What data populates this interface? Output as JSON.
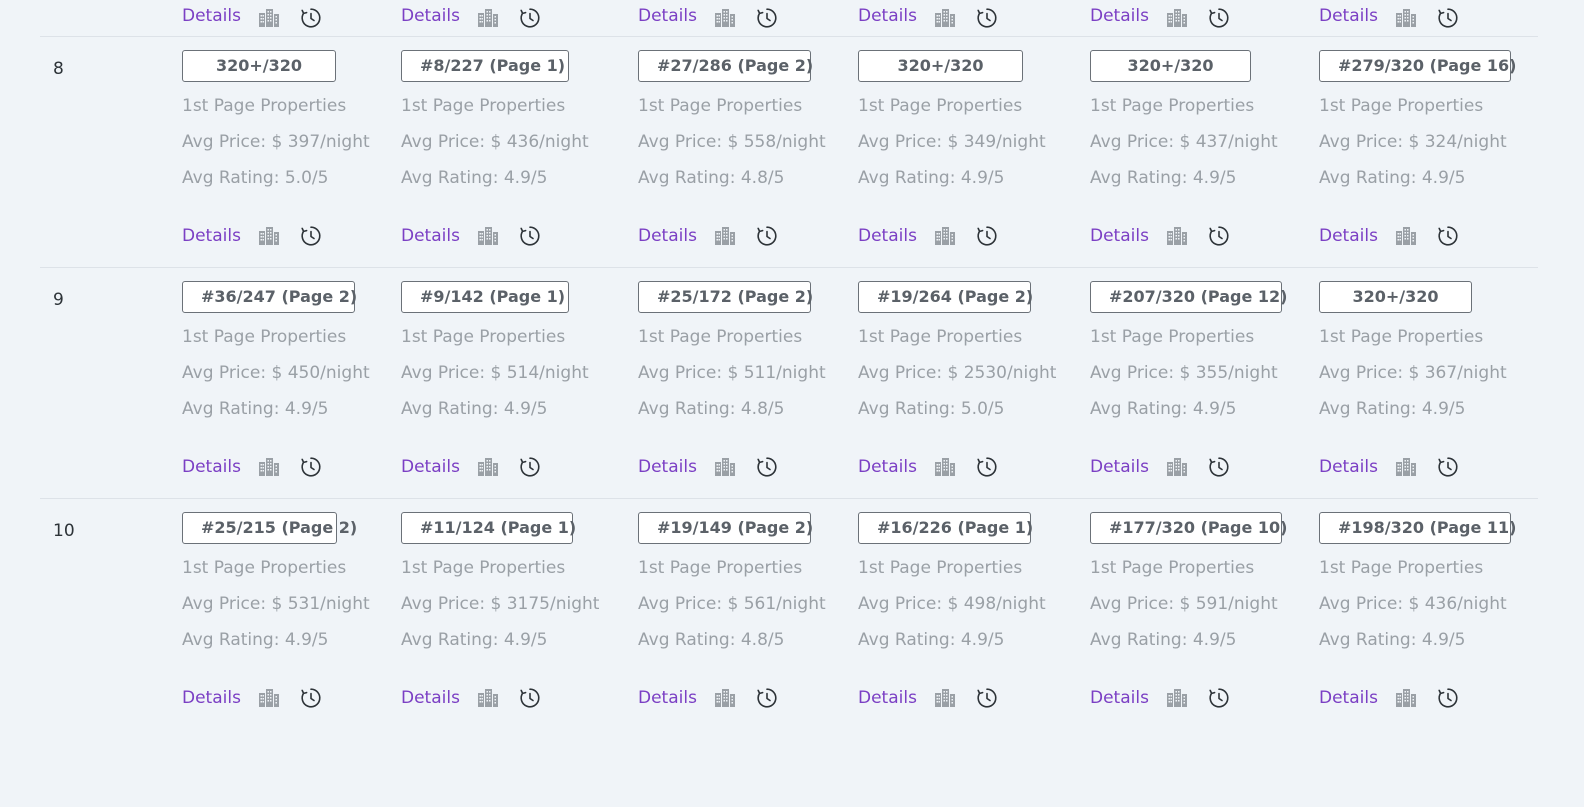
{
  "common": {
    "first_page_label": "1st Page Properties",
    "details_label": "Details",
    "avg_price_prefix": "Avg Price: $ ",
    "avg_price_suffix": "/night",
    "avg_rating_prefix": "Avg Rating: ",
    "avg_rating_suffix": "/5",
    "link_color": "#7b3fc4",
    "icons": [
      "building-icon",
      "history-clock-icon"
    ]
  },
  "rows": [
    {
      "number": "8",
      "cells": [
        {
          "rank": "320+/320",
          "avg_price": "397",
          "avg_rating": "5.0"
        },
        {
          "rank": "#8/227 (Page 1)",
          "avg_price": "436",
          "avg_rating": "4.9"
        },
        {
          "rank": "#27/286 (Page 2)",
          "avg_price": "558",
          "avg_rating": "4.8"
        },
        {
          "rank": "320+/320",
          "avg_price": "349",
          "avg_rating": "4.9"
        },
        {
          "rank": "320+/320",
          "avg_price": "437",
          "avg_rating": "4.9"
        },
        {
          "rank": "#279/320 (Page 16)",
          "avg_price": "324",
          "avg_rating": "4.9"
        }
      ]
    },
    {
      "number": "9",
      "cells": [
        {
          "rank": "#36/247 (Page 2)",
          "avg_price": "450",
          "avg_rating": "4.9"
        },
        {
          "rank": "#9/142 (Page 1)",
          "avg_price": "514",
          "avg_rating": "4.9"
        },
        {
          "rank": "#25/172 (Page 2)",
          "avg_price": "511",
          "avg_rating": "4.8"
        },
        {
          "rank": "#19/264 (Page 2)",
          "avg_price": "2530",
          "avg_rating": "5.0"
        },
        {
          "rank": "#207/320 (Page 12)",
          "avg_price": "355",
          "avg_rating": "4.9"
        },
        {
          "rank": "320+/320",
          "avg_price": "367",
          "avg_rating": "4.9"
        }
      ]
    },
    {
      "number": "10",
      "cells": [
        {
          "rank": "#25/215 (Page 2)",
          "avg_price": "531",
          "avg_rating": "4.9"
        },
        {
          "rank": "#11/124 (Page 1)",
          "avg_price": "3175",
          "avg_rating": "4.9"
        },
        {
          "rank": "#19/149 (Page 2)",
          "avg_price": "561",
          "avg_rating": "4.8"
        },
        {
          "rank": "#16/226 (Page 1)",
          "avg_price": "498",
          "avg_rating": "4.9"
        },
        {
          "rank": "#177/320 (Page 10)",
          "avg_price": "591",
          "avg_rating": "4.9"
        },
        {
          "rank": "#198/320 (Page 11)",
          "avg_price": "436",
          "avg_rating": "4.9"
        }
      ]
    }
  ]
}
